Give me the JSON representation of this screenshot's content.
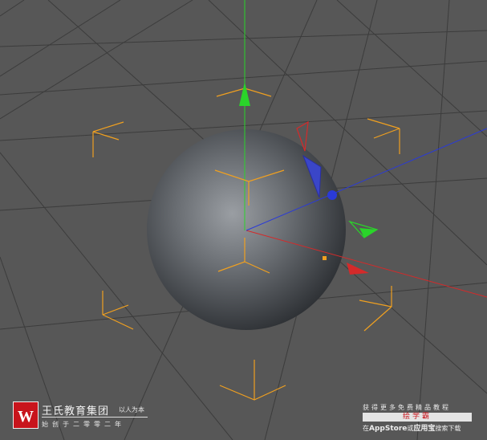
{
  "brand": {
    "name": "王氏教育集团",
    "slogan": "以人为本",
    "subline": "始创于二零零二年",
    "logo_letter": "W"
  },
  "promo": {
    "top_text": "获得更多免费精品教程",
    "app_name": "绘学霸",
    "bottom_prefix": "在",
    "bottom_store": "AppStore",
    "bottom_or": "或",
    "bottom_app": "应用宝",
    "bottom_suffix": "搜索下载"
  },
  "colors": {
    "background": "#575757",
    "grid": "#3c3c3c",
    "x_axis": "#d42a2a",
    "y_axis": "#2ad42a",
    "z_axis": "#2a3ad8",
    "bounding_box": "#f0a020",
    "brand_red": "#c8141c"
  },
  "icons": {
    "logo": "brand-logo-icon",
    "sphere": "sphere-object",
    "gizmo": "move-gizmo"
  }
}
